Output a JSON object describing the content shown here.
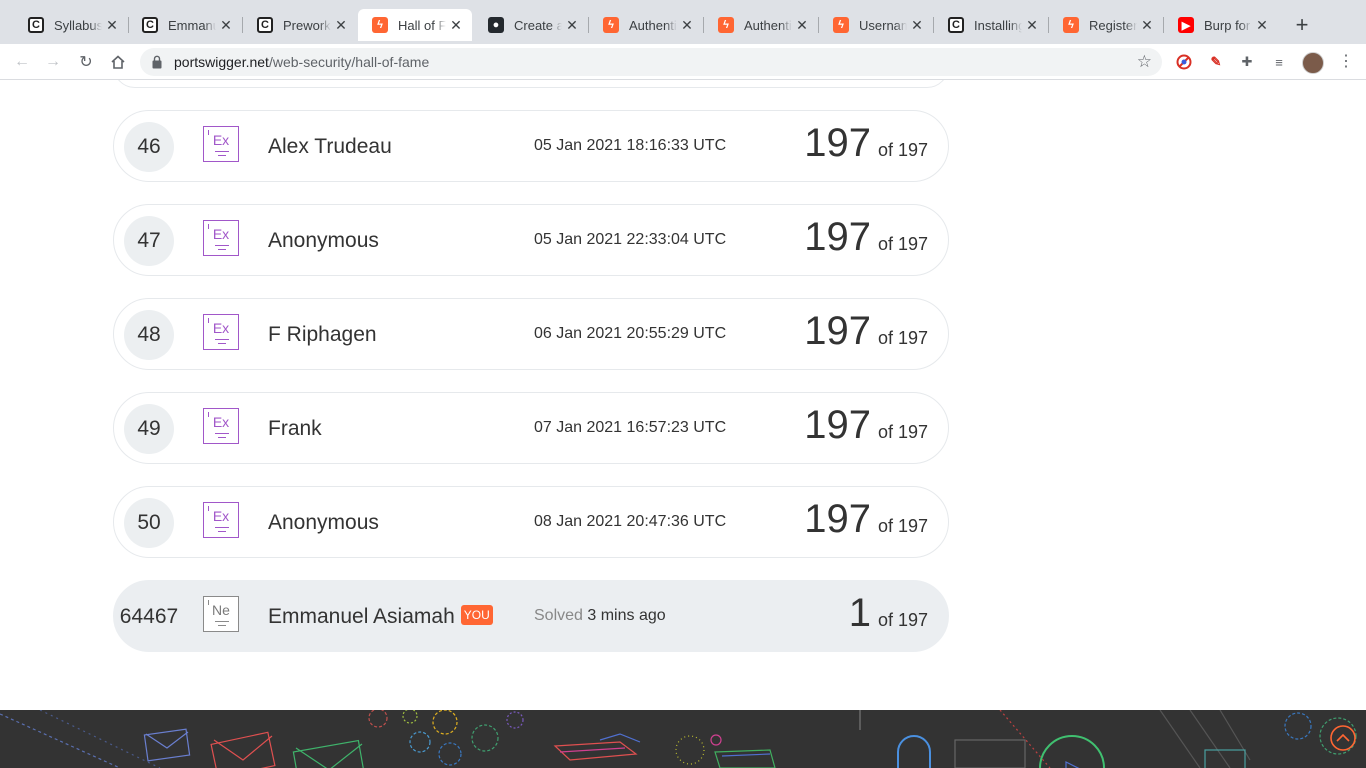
{
  "tabs": [
    {
      "title": "Syllabus",
      "favicon": "codepath-icon"
    },
    {
      "title": "Emmanuel",
      "favicon": "codepath-icon"
    },
    {
      "title": "Prework",
      "favicon": "codepath-icon"
    },
    {
      "title": "Hall of Fame",
      "favicon": "portswigger-icon",
      "active": true
    },
    {
      "title": "Create a",
      "favicon": "github-icon"
    },
    {
      "title": "Authentic",
      "favicon": "portswigger-icon"
    },
    {
      "title": "Authentic",
      "favicon": "portswigger-icon"
    },
    {
      "title": "Usernam",
      "favicon": "portswigger-icon"
    },
    {
      "title": "Installing",
      "favicon": "codepath-icon"
    },
    {
      "title": "Register",
      "favicon": "portswigger-icon"
    },
    {
      "title": "Burp for",
      "favicon": "youtube-icon"
    }
  ],
  "address": {
    "host": "portswigger.net",
    "path": "/web-security/hall-of-fame"
  },
  "leaderboard": {
    "rows": [
      {
        "rank": "46",
        "badge": "Ex",
        "name": "Alex Trudeau",
        "time": "05 Jan 2021 18:16:33 UTC",
        "solved": "197",
        "total": "of 197"
      },
      {
        "rank": "47",
        "badge": "Ex",
        "name": "Anonymous",
        "time": "05 Jan 2021 22:33:04 UTC",
        "solved": "197",
        "total": "of 197"
      },
      {
        "rank": "48",
        "badge": "Ex",
        "name": "F Riphagen",
        "time": "06 Jan 2021 20:55:29 UTC",
        "solved": "197",
        "total": "of 197"
      },
      {
        "rank": "49",
        "badge": "Ex",
        "name": "Frank",
        "time": "07 Jan 2021 16:57:23 UTC",
        "solved": "197",
        "total": "of 197"
      },
      {
        "rank": "50",
        "badge": "Ex",
        "name": "Anonymous",
        "time": "08 Jan 2021 20:47:36 UTC",
        "solved": "197",
        "total": "of 197"
      }
    ],
    "current_user": {
      "rank": "64467",
      "badge": "Ne",
      "name": "Emmanuel Asiamah",
      "you_label": "YOU",
      "solved_label": "Solved",
      "solved_time": "3 mins ago",
      "solved": "1",
      "total": "of 197"
    }
  },
  "colors": {
    "accent": "#ff6633",
    "badge_expert": "#a157c9",
    "footer": "#333333"
  }
}
